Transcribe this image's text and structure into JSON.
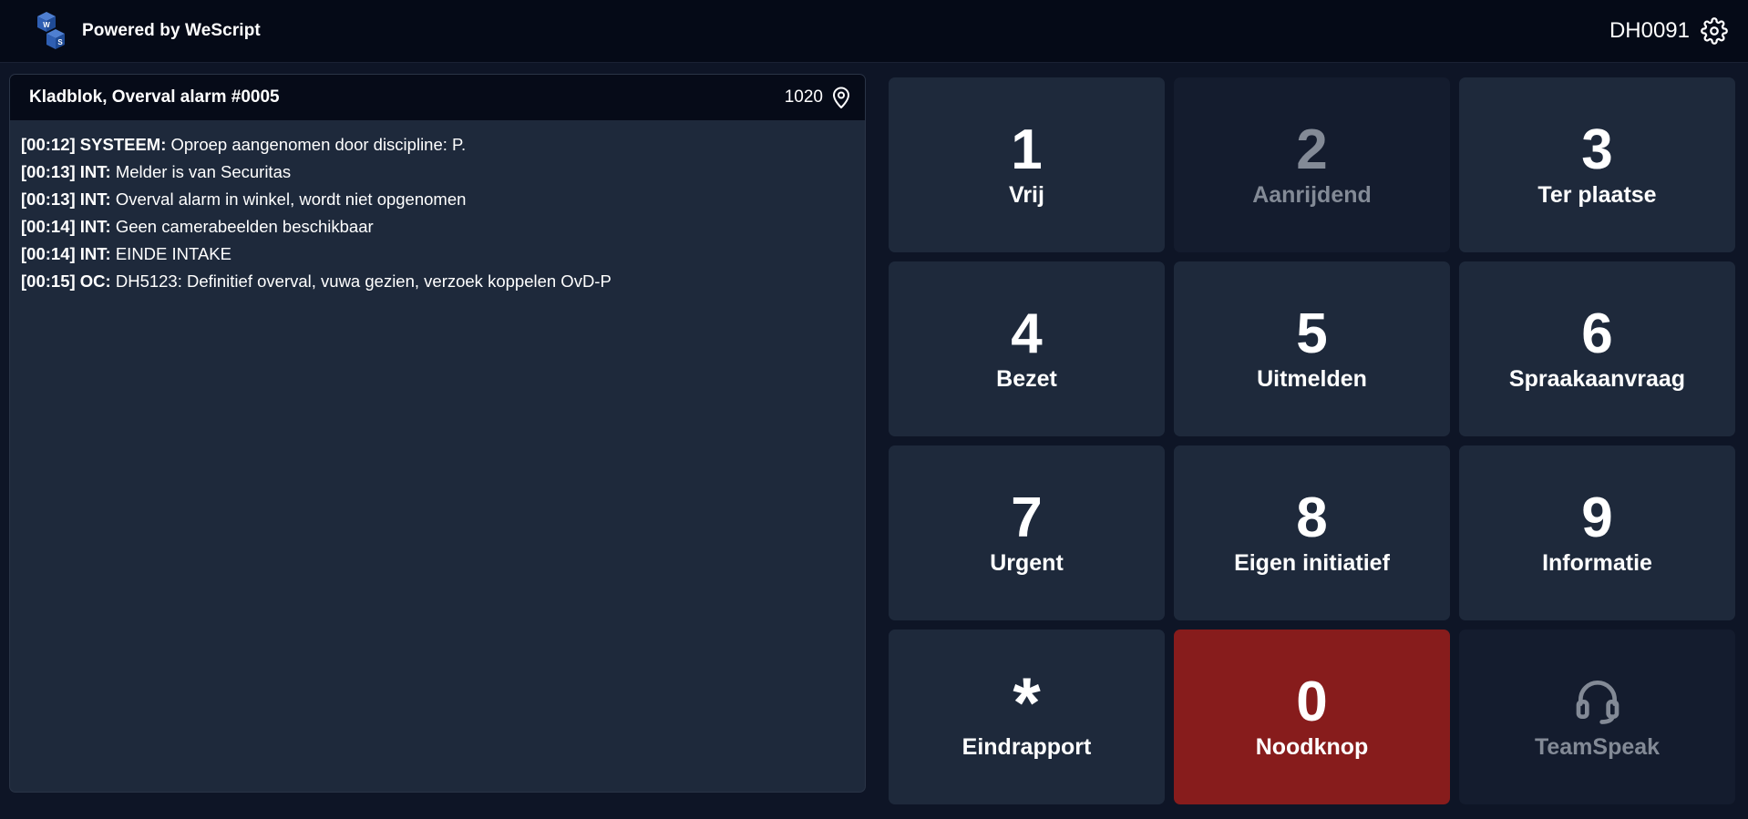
{
  "header": {
    "brand": "Powered by WeScript",
    "logo_letters": [
      "W",
      "S"
    ],
    "user_id": "DH0091",
    "settings_icon": "gear-icon"
  },
  "notepad": {
    "title": "Kladblok, Overval alarm #0005",
    "code": "1020",
    "location_icon": "map-pin-icon",
    "entries": [
      {
        "time": "[00:12]",
        "source": "SYSTEEM:",
        "text": "Oproep aangenomen door discipline: P."
      },
      {
        "time": "[00:13]",
        "source": "INT:",
        "text": "Melder is van Securitas"
      },
      {
        "time": "[00:13]",
        "source": "INT:",
        "text": "Overval alarm in winkel, wordt niet opgenomen"
      },
      {
        "time": "[00:14]",
        "source": "INT:",
        "text": "Geen camerabeelden beschikbaar"
      },
      {
        "time": "[00:14]",
        "source": "INT:",
        "text": "EINDE INTAKE"
      },
      {
        "time": "[00:15]",
        "source": "OC:",
        "text": "DH5123: Definitief overval, vuwa gezien, verzoek koppelen OvD-P"
      }
    ]
  },
  "keypad": {
    "keys": [
      {
        "key": "1",
        "label": "Vrij",
        "state": "normal"
      },
      {
        "key": "2",
        "label": "Aanrijdend",
        "state": "disabled"
      },
      {
        "key": "3",
        "label": "Ter plaatse",
        "state": "normal"
      },
      {
        "key": "4",
        "label": "Bezet",
        "state": "normal"
      },
      {
        "key": "5",
        "label": "Uitmelden",
        "state": "normal"
      },
      {
        "key": "6",
        "label": "Spraakaanvraag",
        "state": "normal"
      },
      {
        "key": "7",
        "label": "Urgent",
        "state": "normal"
      },
      {
        "key": "8",
        "label": "Eigen initiatief",
        "state": "normal"
      },
      {
        "key": "9",
        "label": "Informatie",
        "state": "normal"
      },
      {
        "key": "*",
        "label": "Eindrapport",
        "state": "normal"
      },
      {
        "key": "0",
        "label": "Noodknop",
        "state": "emergency"
      },
      {
        "key": "",
        "label": "TeamSpeak",
        "state": "disabled",
        "icon": "headset-icon"
      }
    ]
  },
  "colors": {
    "background": "#0e1526",
    "topbar": "#050a17",
    "panel": "#1e293b",
    "key_disabled": "#141c2e",
    "emergency": "#871c1c",
    "disabled_text": "#838a96"
  }
}
